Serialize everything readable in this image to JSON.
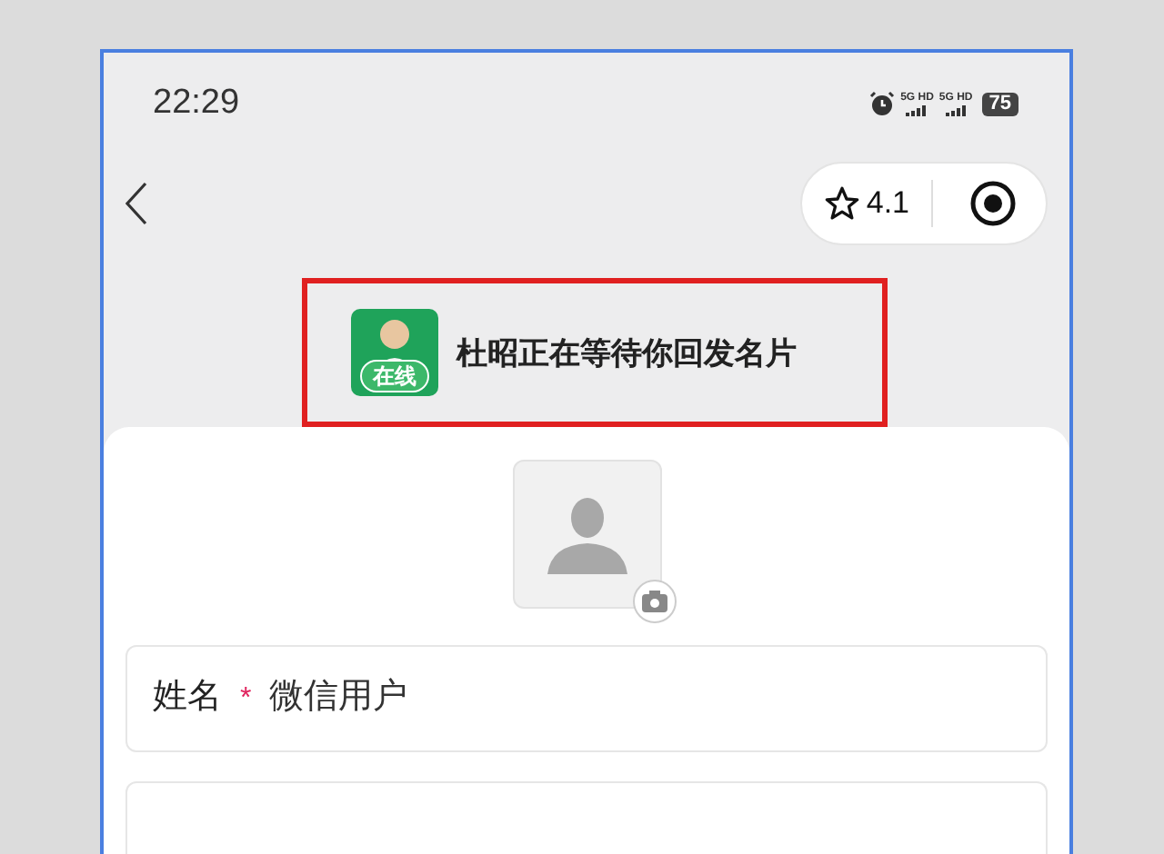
{
  "status_bar": {
    "time": "22:29",
    "networks": [
      "5G HD",
      "5G HD"
    ],
    "battery": "75"
  },
  "nav": {
    "rating": "4.1"
  },
  "banner": {
    "badge": "在线",
    "message": "杜昭正在等待你回发名片"
  },
  "form": {
    "fields": [
      {
        "label": "姓名",
        "required_mark": "*",
        "value": "微信用户"
      }
    ]
  }
}
